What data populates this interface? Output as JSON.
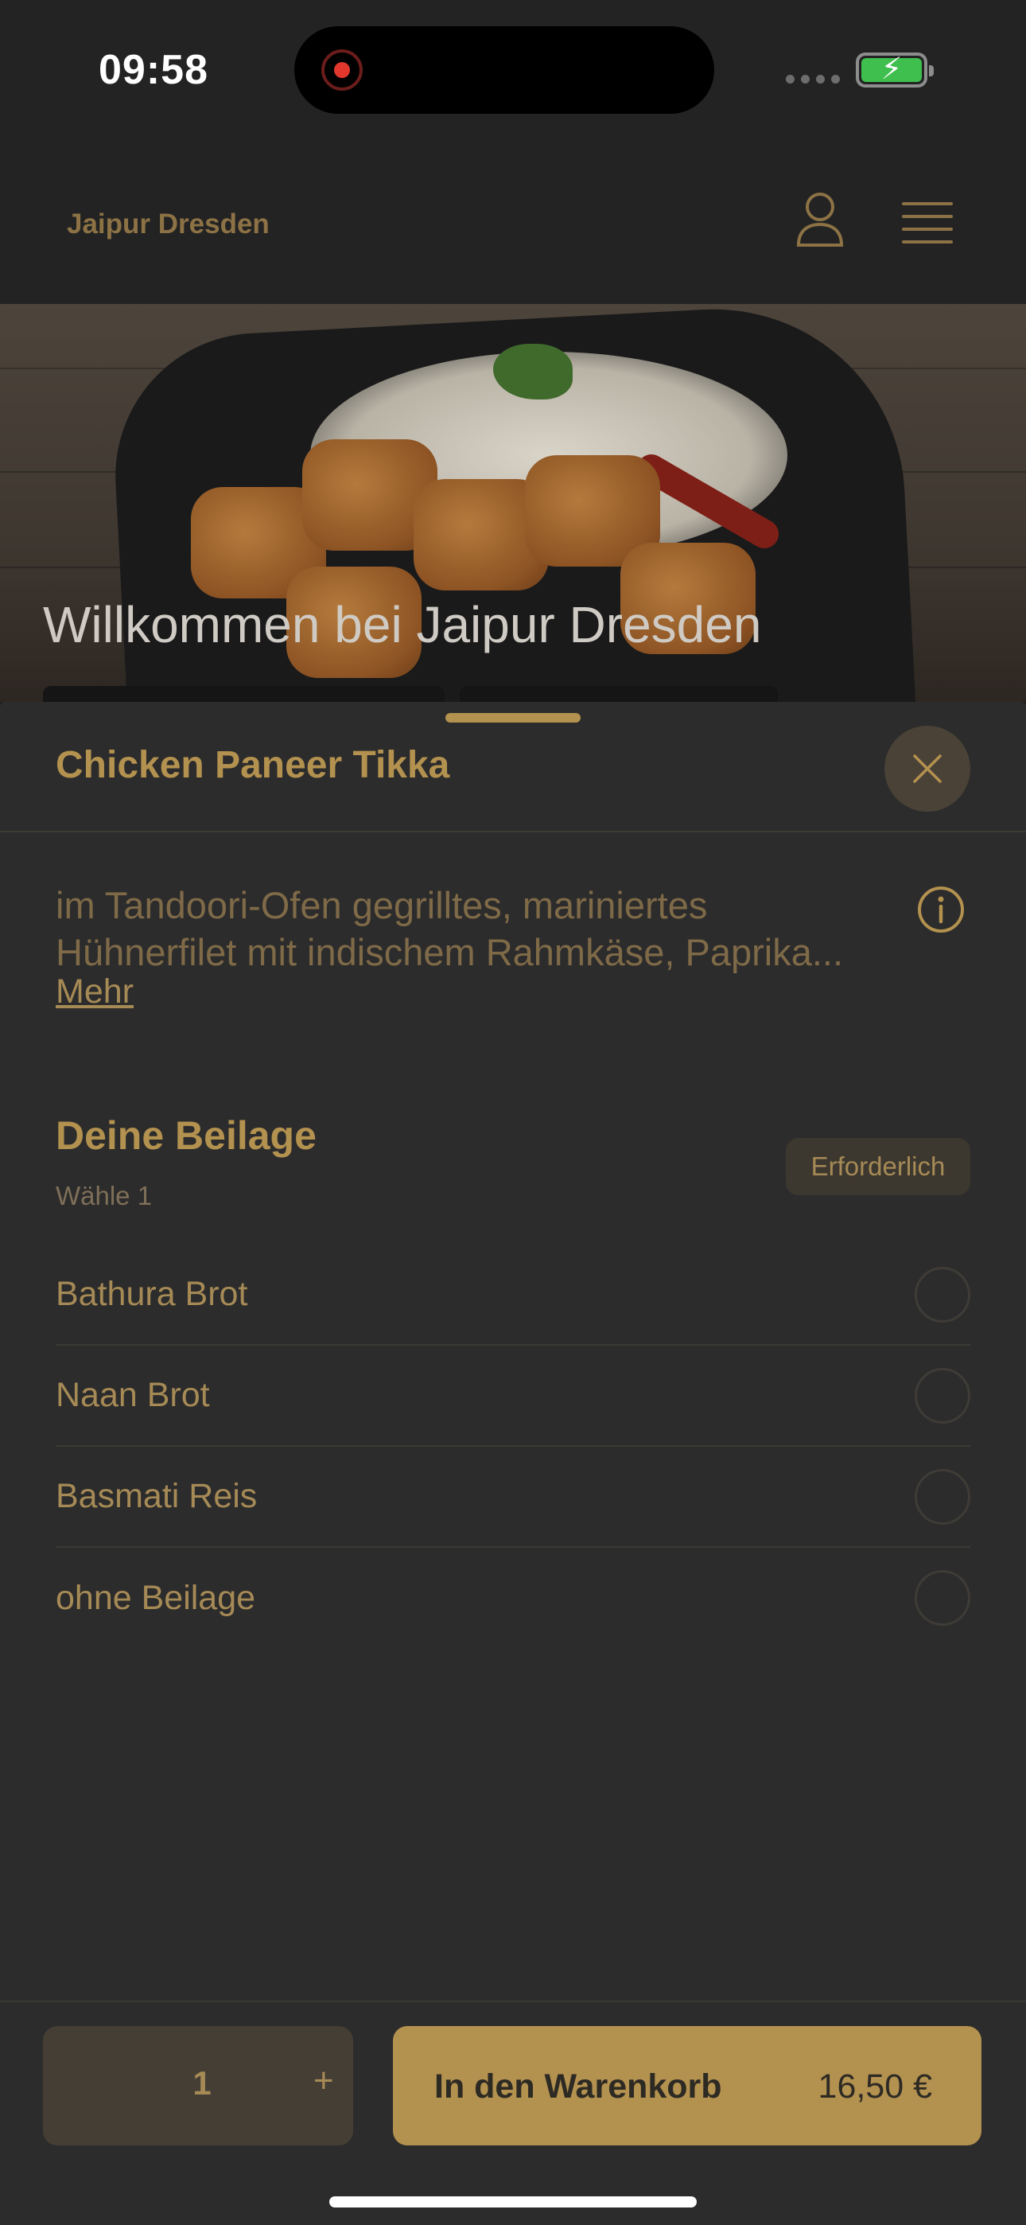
{
  "status_bar": {
    "time": "09:58"
  },
  "header": {
    "brand": "Jaipur Dresden"
  },
  "hero": {
    "title": "Willkommen bei Jaipur Dresden"
  },
  "sheet": {
    "title": "Chicken Paneer Tikka",
    "description_line1": "im Tandoori-Ofen gegrilltes, mariniertes",
    "description_line2": "Hühnerfilet mit indischem Rahmkäse, Paprika...",
    "more_label": "Mehr",
    "section": {
      "title": "Deine Beilage",
      "subtitle": "Wähle 1",
      "badge": "Erforderlich",
      "options": [
        {
          "label": "Bathura Brot",
          "selected": false
        },
        {
          "label": "Naan Brot",
          "selected": false
        },
        {
          "label": "Basmati Reis",
          "selected": false
        },
        {
          "label": "ohne Beilage",
          "selected": false
        }
      ]
    }
  },
  "footer": {
    "quantity": "1",
    "plus_label": "+",
    "cart_label": "In den Warenkorb",
    "price": "16,50 €"
  },
  "colors": {
    "accent": "#b3914f",
    "sheet_bg": "#2c2c2c",
    "close_bg": "#4a4237"
  },
  "icons": [
    "user-icon",
    "menu-icon",
    "close-icon",
    "info-icon",
    "recording-icon",
    "battery-icon"
  ]
}
